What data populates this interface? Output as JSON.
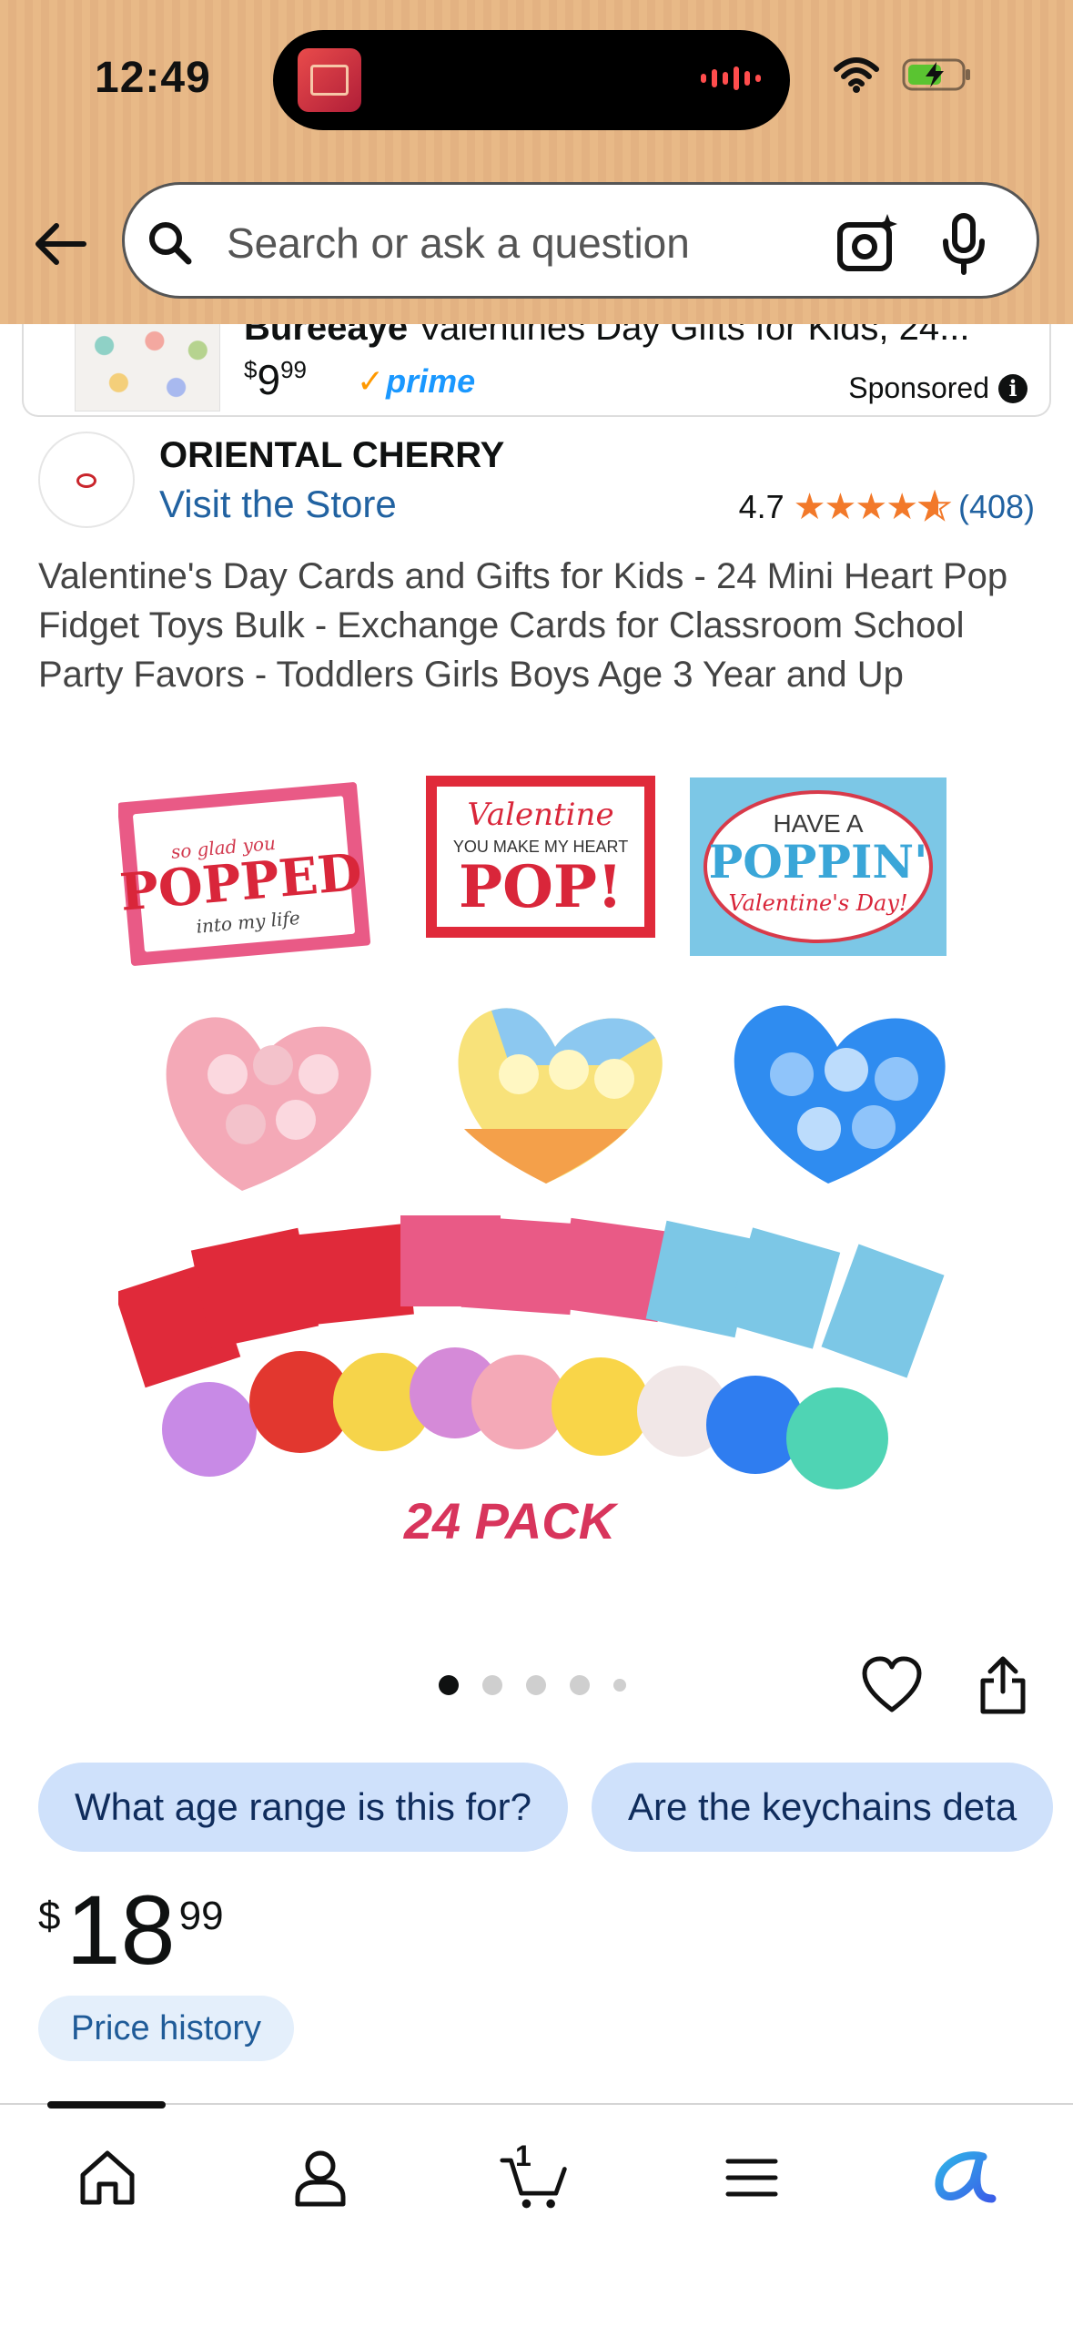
{
  "status_bar": {
    "time": "12:49",
    "island_art_icon": "album-art-icon",
    "wifi_icon": "wifi-icon",
    "battery_icon": "battery-charging-icon"
  },
  "search": {
    "placeholder": "Search or ask a question"
  },
  "sponsored_ad": {
    "brand": "Bureeaye",
    "title_rest": " Valentines Day Gifts for Kids, 24...",
    "price_currency": "$",
    "price_whole": "9",
    "price_fraction": "99",
    "prime_label": "prime",
    "sponsored_label": "Sponsored"
  },
  "brand": {
    "name": "ORIENTAL CHERRY",
    "store_link": "Visit the Store"
  },
  "rating": {
    "value": "4.7",
    "stars": 4.7,
    "count": "(408)"
  },
  "product": {
    "title": "Valentine's Day Cards and Gifts for Kids - 24 Mini Heart Pop Fidget Toys Bulk - Exchange Cards for Classroom School Party Favors - Toddlers Girls Boys Age 3 Year and Up"
  },
  "image_text": {
    "card1_line1": "so glad you",
    "card1_line2": "POPPED",
    "card1_line3": "into my life",
    "card2_line1": "Valentine",
    "card2_line2": "YOU MAKE MY HEART",
    "card2_line3": "POP!",
    "card3_line1": "HAVE A",
    "card3_line2": "POPPIN'",
    "card3_line3": "Valentine's Day!",
    "pack_label": "24 PACK"
  },
  "carousel": {
    "total_dots": 5,
    "active_index": 0
  },
  "questions": [
    "What age range is this for?",
    "Are the keychains deta"
  ],
  "price": {
    "currency": "$",
    "whole": "18",
    "fraction": "99",
    "history_label": "Price history"
  },
  "bottom_nav": {
    "cart_count": "1",
    "items": [
      "home-icon",
      "account-icon",
      "cart-icon",
      "menu-icon",
      "rufus-icon"
    ]
  },
  "colors": {
    "header_bg": "#e8b987",
    "link": "#2162a1",
    "star": "#f2792a",
    "chip_bg": "#cfe1fb",
    "prime_blue": "#1a98ff"
  }
}
